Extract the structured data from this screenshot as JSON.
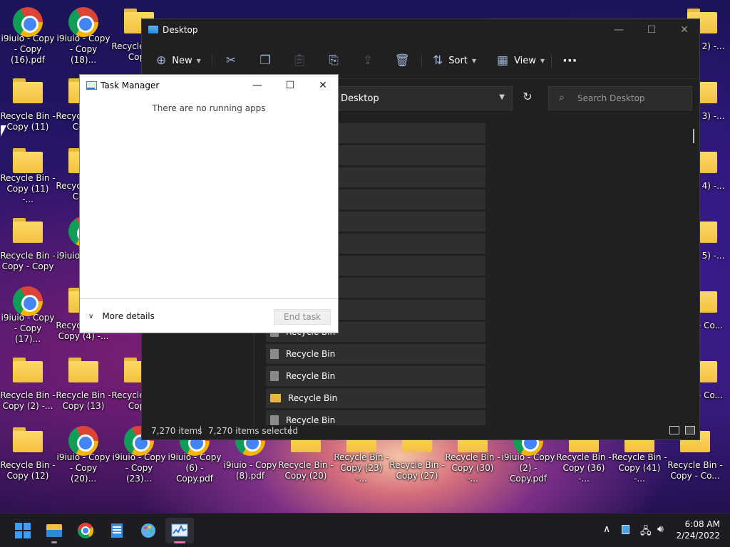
{
  "desktop": {
    "icons": [
      {
        "type": "chrome",
        "label": "i9iuio - Copy - Copy (16).pdf"
      },
      {
        "type": "chrome",
        "label": "i9iuio - Copy - Copy (18)..."
      },
      {
        "type": "folder",
        "label": "Recycle Bin - Copy"
      },
      {
        "type": "folder",
        "label": "Recycle Bin - Copy (11)"
      },
      {
        "type": "folder",
        "label": "Recycle Bin - Copy"
      },
      {
        "type": "folder",
        "label": "Recycle Bin - Copy (11) -..."
      },
      {
        "type": "folder",
        "label": "Recycle Bin - Copy"
      },
      {
        "type": "folder",
        "label": "Recycle Bin - Copy - Copy"
      },
      {
        "type": "chrome",
        "label": "i9iuio - Copy"
      },
      {
        "type": "chrome",
        "label": "i9iuio - Copy - Copy (17)..."
      },
      {
        "type": "folder",
        "label": "Recycle Bin - Copy (4) -..."
      },
      {
        "type": "folder",
        "label": "Copy"
      },
      {
        "type": "folder",
        "label": "Recycle Bin - Copy (2) -..."
      },
      {
        "type": "folder",
        "label": "Recycle Bin - Copy (13)"
      },
      {
        "type": "folder",
        "label": "Recycle Bin - Copy"
      },
      {
        "type": "folder",
        "label": "Recycle Bin - Copy (12)"
      },
      {
        "type": "chrome",
        "label": "i9iuio - Copy - Copy (20)..."
      },
      {
        "type": "chrome",
        "label": "i9iuio - Copy - Copy (23)..."
      },
      {
        "type": "chrome",
        "label": "i9iuio - Copy (6) - Copy.pdf"
      },
      {
        "type": "chrome",
        "label": "i9iuio - Copy (8).pdf"
      },
      {
        "type": "folder",
        "label": "Recycle Bin - Copy (20)"
      },
      {
        "type": "folder",
        "label": "Recycle Bin - Copy (23) -..."
      },
      {
        "type": "folder",
        "label": "Recycle Bin - Copy (27)"
      },
      {
        "type": "folder",
        "label": "Recycle Bin - Copy (30) -..."
      },
      {
        "type": "chrome",
        "label": "i9iuio - Copy (2) - Copy.pdf"
      },
      {
        "type": "folder",
        "label": "Recycle Bin - Copy (36) -..."
      },
      {
        "type": "folder",
        "label": "Recycle Bin - Copy (41) -..."
      },
      {
        "type": "folder",
        "label": "Recycle Bin - Copy - Co..."
      },
      {
        "type": "folder",
        "label": "Bin - 2) -..."
      },
      {
        "type": "folder",
        "label": "Bin - 3) -..."
      },
      {
        "type": "folder",
        "label": "Bin - 4) -..."
      },
      {
        "type": "folder",
        "label": "Bin - 5) -..."
      },
      {
        "type": "folder",
        "label": "Bin - Co..."
      },
      {
        "type": "folder",
        "label": "Bin - Co..."
      }
    ]
  },
  "explorer": {
    "title": "Desktop",
    "minimize": "—",
    "maximize": "☐",
    "close": "✕",
    "new_label": "New",
    "sort_label": "Sort",
    "view_label": "View",
    "more_label": "···",
    "address": "Desktop",
    "search_placeholder": "Search Desktop",
    "rows": [
      {
        "name": "",
        "kind": "file"
      },
      {
        "name": "",
        "kind": "file"
      },
      {
        "name": "",
        "kind": "file"
      },
      {
        "name": "",
        "kind": "file"
      },
      {
        "name": "",
        "kind": "file"
      },
      {
        "name": "",
        "kind": "file"
      },
      {
        "name": "",
        "kind": "file"
      },
      {
        "name": "",
        "kind": "file"
      },
      {
        "name": "",
        "kind": "file"
      },
      {
        "name": "Recycle Bin",
        "kind": "file"
      },
      {
        "name": "Recycle Bin",
        "kind": "file"
      },
      {
        "name": "Recycle Bin",
        "kind": "file"
      },
      {
        "name": "Recycle Bin",
        "kind": "folder"
      },
      {
        "name": "Recycle Bin",
        "kind": "file"
      }
    ],
    "status_items": "7,270 items",
    "status_selected": "7,270 items selected"
  },
  "taskmanager": {
    "title": "Task Manager",
    "minimize": "—",
    "maximize": "☐",
    "close": "✕",
    "empty_message": "There are no running apps",
    "more_details": "More details",
    "end_task": "End task"
  },
  "taskbar": {
    "time": "6:08 AM",
    "date": "2/24/2022",
    "tray_chevron": "∧"
  },
  "colors": {
    "explorer_bg": "#202020",
    "row_bg": "#2f2f2f",
    "taskbar_bg": "#1c1c22",
    "active_indicator": "#e86fb3"
  }
}
